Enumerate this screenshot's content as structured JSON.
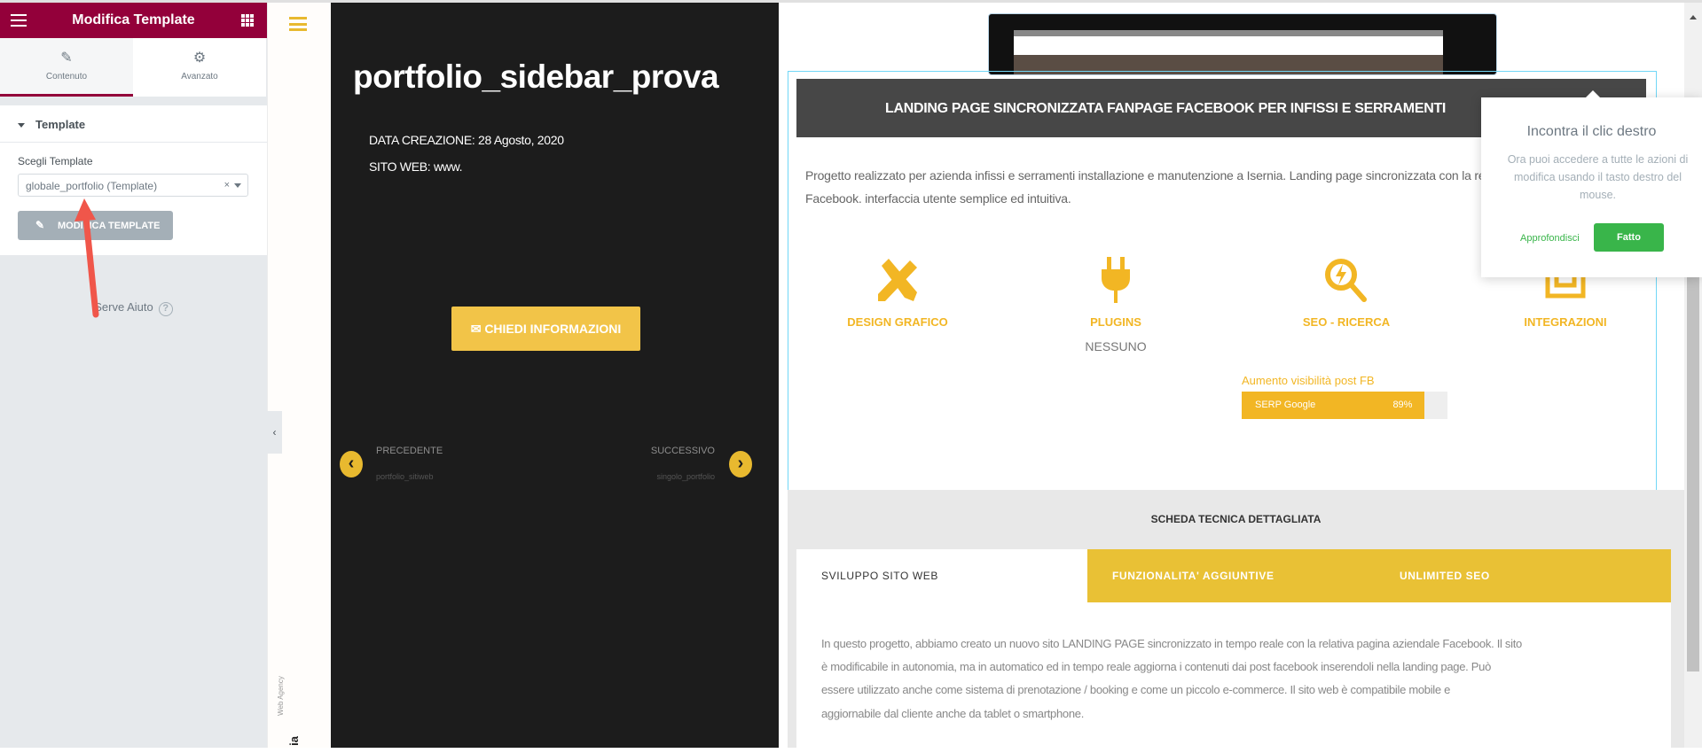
{
  "editor": {
    "title": "Modifica Template",
    "tabs": [
      {
        "label": "Contenuto",
        "icon": "pencil-icon"
      },
      {
        "label": "Avanzato",
        "icon": "gear-icon"
      }
    ],
    "section_title": "Template",
    "field_label": "Scegli Template",
    "select_value": "globale_portfolio (Template)",
    "edit_button": "MODIFICA TEMPLATE",
    "help": "Serve Aiuto",
    "accent": "#93003a"
  },
  "strip": {
    "agency": "Web Agency",
    "brand": "ia"
  },
  "hero": {
    "title": "portfolio_sidebar_prova",
    "date": "DATA CREAZIONE: 28 Agosto, 2020",
    "site": "SITO WEB: www.",
    "cta": "CHIEDI INFORMAZIONI",
    "prev_label": "PRECEDENTE",
    "prev_title": "portfolio_sitiweb",
    "next_label": "SUCCESSIVO",
    "next_title": "singolo_portfolio"
  },
  "content": {
    "heading": "LANDING PAGE SINCRONIZZATA FANPAGE FACEBOOK PER INFISSI E SERRAMENTI",
    "intro": [
      "Progetto realizzato per azienda infissi e serramenti installazione e manutenzione a Isernia. Landing page sincronizzata con la relativa pagina aziendale",
      "Facebook. interfaccia utente semplice ed intuitiva."
    ],
    "features": [
      {
        "label": "DESIGN GRAFICO",
        "icon": "design-tools-icon"
      },
      {
        "label": "PLUGINS",
        "icon": "plug-icon",
        "sub": "NESSUNO"
      },
      {
        "label": "SEO - RICERCA",
        "icon": "seo-search-icon"
      },
      {
        "label": "INTEGRAZIONI",
        "icon": "integrations-icon"
      }
    ],
    "progress": {
      "title": "Aumento visibilità post FB",
      "name": "SERP Google",
      "value_label": "89%",
      "value": 89
    },
    "accent": "#f2b624"
  },
  "scheda": {
    "title": "SCHEDA TECNICA DETTAGLIATA",
    "tabs": [
      "SVILUPPO SITO WEB",
      "FUNZIONALITA' AGGIUNTIVE",
      "UNLIMITED SEO"
    ],
    "body": [
      "In questo progetto, abbiamo creato un nuovo sito LANDING PAGE sincronizzato in tempo reale con la relativa pagina aziendale Facebook. Il sito",
      "è modificabile in autonomia, ma in automatico ed in tempo reale aggiorna i contenuti dai post facebook inserendoli nella landing page. Può",
      "essere utilizzato anche come sistema di prenotazione / booking e come un piccolo e-commerce. Il sito web è compatibile mobile e",
      "aggiornabile dal cliente anche da tablet o smartphone."
    ]
  },
  "popup": {
    "title": "Incontra il clic destro",
    "body": "Ora puoi accedere a tutte le azioni di modifica usando il tasto destro del mouse.",
    "link": "Approfondisci",
    "button": "Fatto",
    "accent": "#39b54a"
  }
}
